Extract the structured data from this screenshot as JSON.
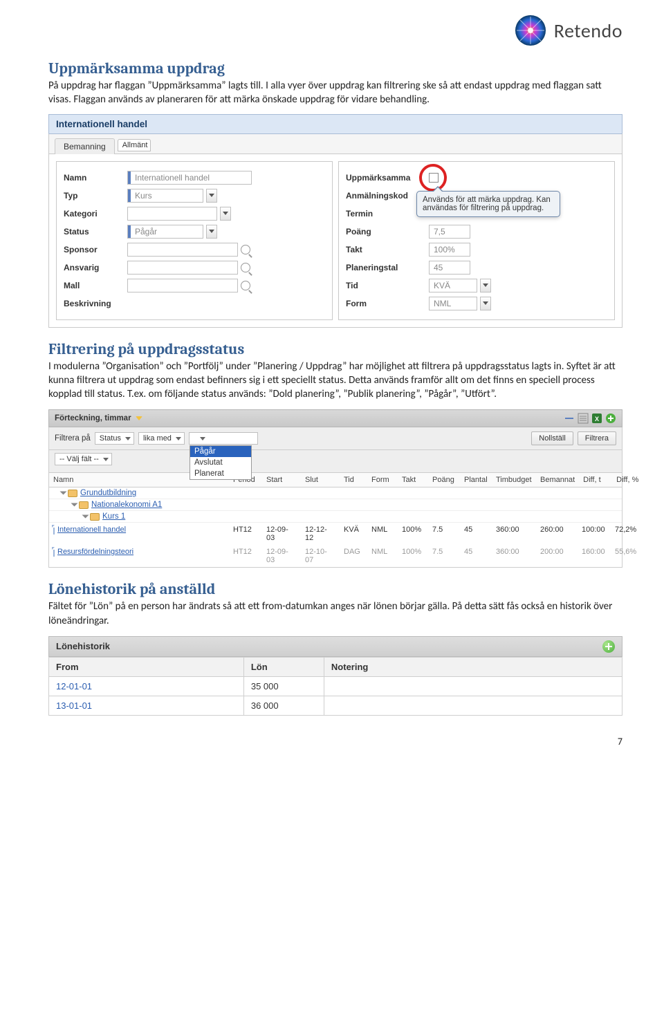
{
  "brand": {
    "name": "Retendo"
  },
  "sec1": {
    "title": "Uppmärksamma uppdrag",
    "p1": "På uppdrag har flaggan ”Uppmärksamma” lagts till. I alla vyer över uppdrag kan filtrering ske så att endast uppdrag med flaggan satt visas. Flaggan används av planeraren för att märka önskade uppdrag för vidare behandling."
  },
  "ss1": {
    "panel_title": "Internationell handel",
    "tabs": {
      "bemanning": "Bemanning",
      "allmant": "Allmänt"
    },
    "left": {
      "namn_label": "Namn",
      "namn_value": "Internationell handel",
      "typ_label": "Typ",
      "typ_value": "Kurs",
      "kategori_label": "Kategori",
      "status_label": "Status",
      "status_value": "Pågår",
      "sponsor_label": "Sponsor",
      "ansvarig_label": "Ansvarig",
      "mall_label": "Mall",
      "beskrivning_label": "Beskrivning"
    },
    "right": {
      "uppmarksamma_label": "Uppmärksamma",
      "anmkod_label": "Anmälningskod",
      "termin_label": "Termin",
      "poang_label": "Poäng",
      "poang_value": "7,5",
      "takt_label": "Takt",
      "takt_value": "100%",
      "planeringstal_label": "Planeringstal",
      "planeringstal_value": "45",
      "tid_label": "Tid",
      "tid_value": "KVÄ",
      "form_label": "Form",
      "form_value": "NML"
    },
    "tooltip": "Används för att märka uppdrag. Kan användas för filtrering på uppdrag."
  },
  "sec2": {
    "title": "Filtrering på uppdragsstatus",
    "p1": "I modulerna ”Organisation” och ”Portfölj” under ”Planering / Uppdrag” har möjlighet att filtrera på uppdragsstatus lagts in. Syftet är att kunna filtrera ut uppdrag som endast befinners sig i ett speciellt status. Detta används framför allt om det finns en speciell process kopplad till status. T.ex. om följande status används: ”Dold planering”, ”Publik planering”, ”Pågår”, ”Utfört”."
  },
  "ss2": {
    "bar_title": "Förteckning, timmar",
    "filter_label": "Filtrera på",
    "field_status": "Status",
    "op_lika": "lika med",
    "placeholder_valj": "-- Välj fält --",
    "btn_nollstall": "Nollställ",
    "btn_filtrera": "Filtrera",
    "options": {
      "pagar": "Pågår",
      "avslutat": "Avslutat",
      "planerat": "Planerat"
    },
    "cols": {
      "namn": "Namn",
      "period": "Period",
      "start": "Start",
      "slut": "Slut",
      "tid": "Tid",
      "form": "Form",
      "takt": "Takt",
      "poang": "Poäng",
      "plantal": "Plantal",
      "timbudget": "Timbudget",
      "bemannat": "Bemannat",
      "difft": "Diff, t",
      "diffp": "Diff, %"
    },
    "tree": {
      "grund": "Grundutbildning",
      "nat": "Nationalekonomi A1",
      "kurs1": "Kurs 1",
      "row1_name": "Internationell handel",
      "row2_name": "Resursfördelningsteori"
    },
    "rows": [
      {
        "per": "HT12",
        "st": "12-09-03",
        "sl": "12-12-12",
        "tid": "KVÄ",
        "form": "NML",
        "takt": "100%",
        "po": "7.5",
        "pl": "45",
        "tb": "360:00",
        "bm": "260:00",
        "dt": "100:00",
        "dp": "72,2%"
      },
      {
        "per": "HT12",
        "st": "12-09-03",
        "sl": "12-10-07",
        "tid": "DAG",
        "form": "NML",
        "takt": "100%",
        "po": "7.5",
        "pl": "45",
        "tb": "360:00",
        "bm": "200:00",
        "dt": "160:00",
        "dp": "55,6%"
      }
    ]
  },
  "sec3": {
    "title": "Lönehistorik på anställd",
    "p1": "Fältet för ”Lön” på en person har ändrats så att ett from-datumkan anges när lönen börjar gälla. På detta sätt fås också en historik över löneändringar."
  },
  "ss3": {
    "title": "Lönehistorik",
    "col_from": "From",
    "col_lon": "Lön",
    "col_notering": "Notering",
    "rows": [
      {
        "from": "12-01-01",
        "lon": "35 000",
        "not": ""
      },
      {
        "from": "13-01-01",
        "lon": "36 000",
        "not": ""
      }
    ]
  },
  "pagenum": "7"
}
